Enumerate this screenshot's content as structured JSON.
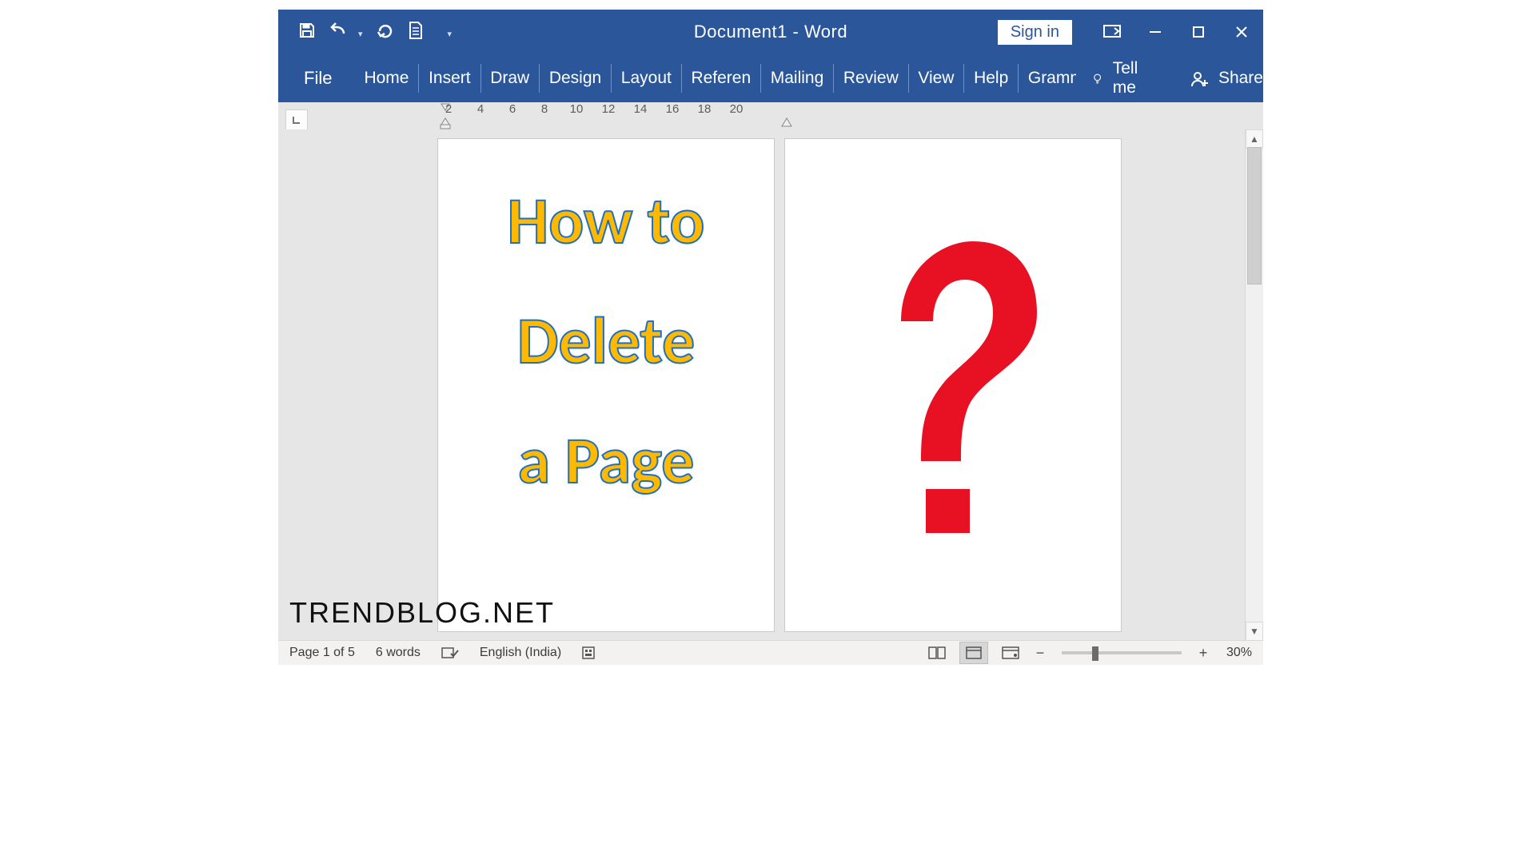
{
  "title": "Document1  -  Word",
  "signin": "Sign in",
  "tabs": {
    "file": "File",
    "items": [
      "Home",
      "Insert",
      "Draw",
      "Design",
      "Layout",
      "Referen",
      "Mailing",
      "Review",
      "View",
      "Help",
      "Gramma"
    ],
    "tellme": "Tell me",
    "share": "Share"
  },
  "ruler": {
    "values": [
      "2",
      "4",
      "6",
      "8",
      "10",
      "12",
      "14",
      "16",
      "18",
      "20"
    ]
  },
  "document": {
    "page1": {
      "line1": "How to",
      "line2": "Delete",
      "line3": "a Page"
    }
  },
  "status": {
    "page": "Page 1 of 5",
    "words": "6 words",
    "language": "English (India)",
    "zoom": "30%"
  },
  "watermark": "TRENDBLOG.NET"
}
